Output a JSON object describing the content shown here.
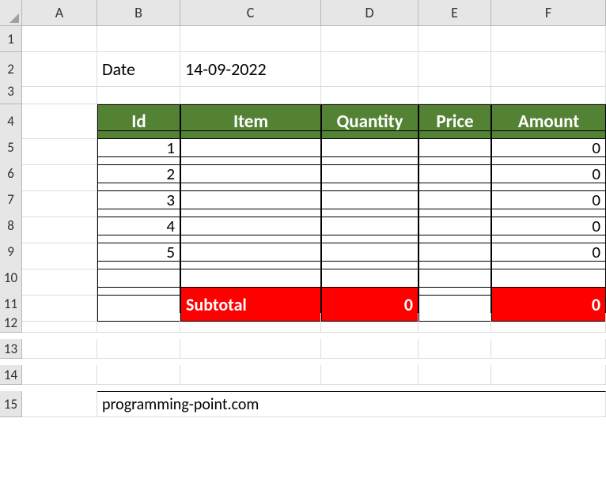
{
  "columns": [
    "A",
    "B",
    "C",
    "D",
    "E",
    "F"
  ],
  "rows": [
    "1",
    "2",
    "3",
    "4",
    "5",
    "6",
    "7",
    "8",
    "9",
    "10",
    "11",
    "12",
    "13",
    "14",
    "15"
  ],
  "meta": {
    "date_label": "Date",
    "date_value": "14-09-2022",
    "footer": "programming-point.com"
  },
  "headers": {
    "id": "Id",
    "item": "Item",
    "quantity": "Quantity",
    "price": "Price",
    "amount": "Amount"
  },
  "items": [
    {
      "id": "1",
      "item": "",
      "quantity": "",
      "price": "",
      "amount": "0"
    },
    {
      "id": "2",
      "item": "",
      "quantity": "",
      "price": "",
      "amount": "0"
    },
    {
      "id": "3",
      "item": "",
      "quantity": "",
      "price": "",
      "amount": "0"
    },
    {
      "id": "4",
      "item": "",
      "quantity": "",
      "price": "",
      "amount": "0"
    },
    {
      "id": "5",
      "item": "",
      "quantity": "",
      "price": "",
      "amount": "0"
    }
  ],
  "subtotal": {
    "label": "Subtotal",
    "quantity": "0",
    "amount": "0"
  }
}
